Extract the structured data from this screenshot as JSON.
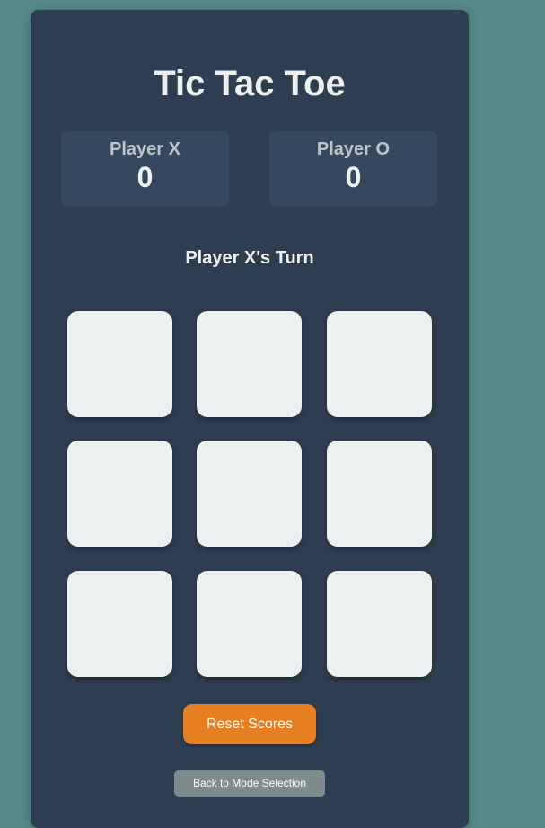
{
  "game": {
    "title": "Tic Tac Toe",
    "status": "Player X's Turn",
    "scores": {
      "x": {
        "label": "Player X",
        "value": "0"
      },
      "o": {
        "label": "Player O",
        "value": "0"
      }
    },
    "board": [
      "",
      "",
      "",
      "",
      "",
      "",
      "",
      "",
      ""
    ],
    "buttons": {
      "reset": "Reset Scores",
      "back": "Back to Mode Selection"
    }
  },
  "colors": {
    "page_background": "#568887",
    "card_background": "#2e3e51",
    "score_box": "#34495e",
    "cell": "#ecf0f1",
    "reset_button": "#e67e22",
    "back_button": "#7f8c8d"
  }
}
